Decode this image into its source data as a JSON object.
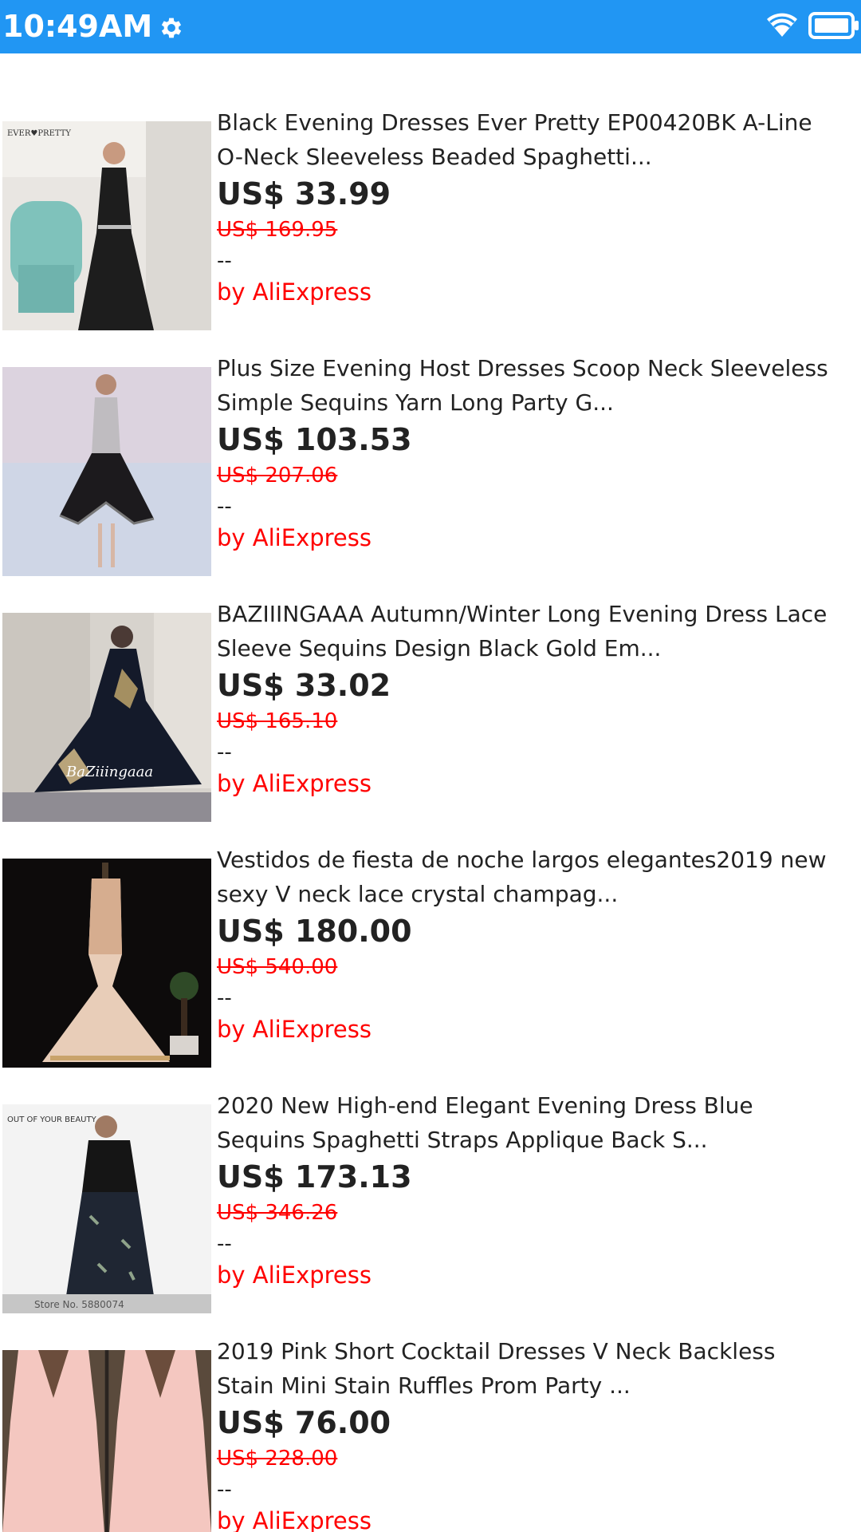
{
  "status_bar": {
    "time": "10:49AM",
    "color": "#2196f3",
    "icons": [
      "gear-icon",
      "wifi-icon",
      "battery-icon"
    ]
  },
  "products": [
    {
      "title_line1": "Black Evening Dresses Ever Pretty EP00420BK A-Line",
      "title_line2": "O-Neck Sleeveless Beaded Spaghetti...",
      "price": "US$ 33.99",
      "original_price": "US$ 169.95",
      "rating": "--",
      "seller": "by AliExpress",
      "image_label": "EVER♥PRETTY"
    },
    {
      "title_line1": "Plus Size Evening Host Dresses Scoop Neck Sleeveless",
      "title_line2": "Simple Sequins Yarn Long Party G...",
      "price": "US$ 103.53",
      "original_price": "US$ 207.06",
      "rating": "--",
      "seller": "by AliExpress",
      "image_label": ""
    },
    {
      "title_line1": "BAZIIINGAAA Autumn/Winter Long Evening Dress Lace",
      "title_line2": "Sleeve Sequins Design Black Gold Em...",
      "price": "US$ 33.02",
      "original_price": "US$ 165.10",
      "rating": "--",
      "seller": "by AliExpress",
      "image_label": "BaZiiingaaa"
    },
    {
      "title_line1": "Vestidos de fiesta de noche largos elegantes2019 new",
      "title_line2": "sexy V neck lace crystal champag...",
      "price": "US$ 180.00",
      "original_price": "US$ 540.00",
      "rating": "--",
      "seller": "by AliExpress",
      "image_label": ""
    },
    {
      "title_line1": "2020 New High-end Elegant Evening Dress Blue",
      "title_line2": "Sequins Spaghetti Straps Applique Back S...",
      "price": "US$ 173.13",
      "original_price": "US$ 346.26",
      "rating": "--",
      "seller": "by AliExpress",
      "image_label": "OUT OF YOUR BEAUTY",
      "image_footer": "Store No. 5880074"
    },
    {
      "title_line1": "2019 Pink Short Cocktail Dresses V Neck Backless",
      "title_line2": "Stain Mini Stain Ruffles Prom Party ...",
      "price": "US$ 76.00",
      "original_price": "US$ 228.00",
      "rating": "--",
      "seller": "by AliExpress",
      "image_label": ""
    }
  ]
}
